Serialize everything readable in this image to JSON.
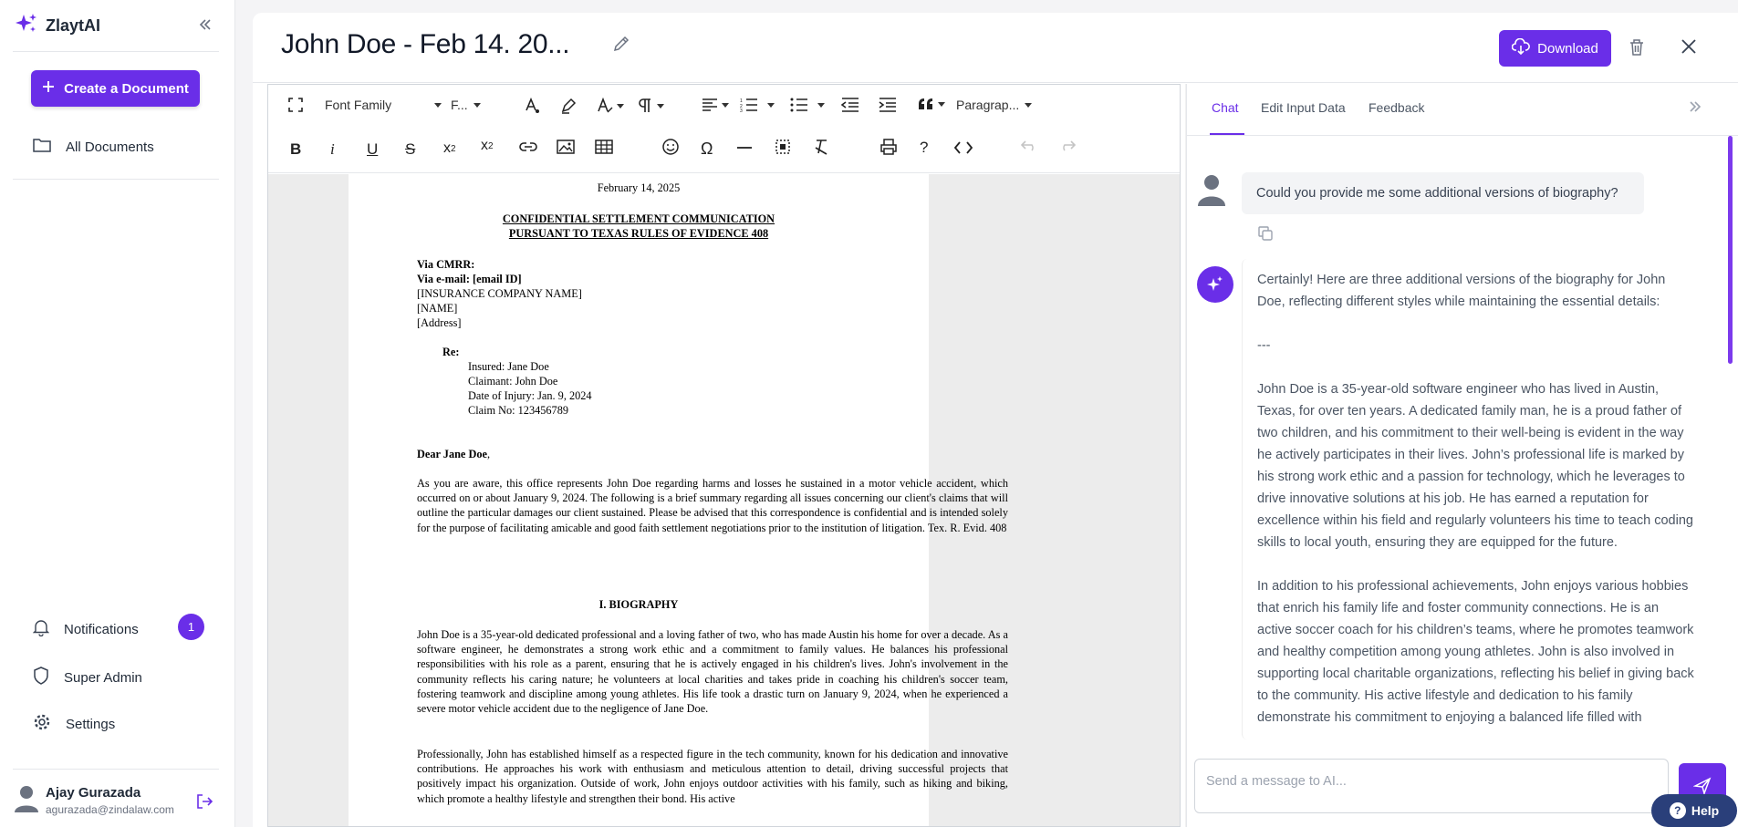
{
  "app": {
    "name": "ZlaytAI"
  },
  "sidebar": {
    "create_label": "Create a Document",
    "all_documents": "All Documents",
    "notifications": "Notifications",
    "notifications_count": "1",
    "super_admin": "Super Admin",
    "settings": "Settings",
    "user_name": "Ajay Gurazada",
    "user_email": "agurazada@zindalaw.com"
  },
  "header": {
    "title": "John Doe - Feb 14. 20...",
    "download_label": "Download"
  },
  "toolbar": {
    "font_family": "Font Family",
    "font_size": "F...",
    "paragraph": "Paragrap..."
  },
  "document": {
    "date": "February 14, 2025",
    "heading1": "CONFIDENTIAL SETTLEMENT COMMUNICATION",
    "heading2": "PURSUANT TO TEXAS RULES OF EVIDENCE 408",
    "via_cmrr": "Via CMRR:",
    "via_email": "Via e-mail: [email ID]",
    "insurance": "[INSURANCE COMPANY NAME]",
    "name": "[NAME]",
    "address": "[Address]",
    "re": "Re:",
    "insured": "Insured: Jane Doe",
    "claimant": "Claimant: John Doe",
    "doi": "Date of Injury: Jan. 9, 2024",
    "claim_no": "Claim No: 123456789",
    "salutation_bold": "Dear Jane Doe",
    "salutation_rest": ",",
    "intro": "As you are aware, this office represents John Doe regarding harms and losses he sustained in a motor vehicle accident, which occurred on or about January 9, 2024. The following is a brief summary regarding all issues concerning our client's claims that will outline the particular damages our client sustained. Please be advised that this correspondence is confidential and is intended solely for the purpose of facilitating amicable and good faith settlement negotiations prior to the institution of litigation. Tex. R. Evid. 408",
    "section_title": "I. BIOGRAPHY",
    "bio1": "John Doe is a 35-year-old dedicated professional and a loving father of two, who has made Austin his home for over a decade. As a software engineer, he demonstrates a strong work ethic and a commitment to family values. He balances his professional responsibilities with his role as a parent, ensuring that he is actively engaged in his children's lives. John's involvement in the community reflects his caring nature; he volunteers at local charities and takes pride in coaching his children's soccer team, fostering teamwork and discipline among young athletes. His life took a drastic turn on January 9, 2024, when he experienced a severe motor vehicle accident due to the negligence of Jane Doe.",
    "bio2": "Professionally, John has established himself as a respected figure in the tech community, known for his dedication and innovative contributions. He approaches his work with enthusiasm and meticulous attention to detail, driving successful projects that positively impact his organization. Outside of work, John enjoys outdoor activities with his family, such as hiking and biking, which promote a healthy lifestyle and strengthen their bond. His active"
  },
  "chat": {
    "tabs": [
      "Chat",
      "Edit Input Data",
      "Feedback"
    ],
    "user_message": "Could you provide me some additional versions of biography?",
    "ai_p1": "Certainly! Here are three additional versions of the biography for John Doe, reflecting different styles while maintaining the essential details:",
    "ai_p2": "---",
    "ai_p3": "John Doe is a 35-year-old software engineer who has lived in Austin, Texas, for over ten years. A dedicated family man, he is a proud father of two children, and his commitment to their well-being is evident in the way he actively participates in their lives. John’s professional life is marked by his strong work ethic and a passion for technology, which he leverages to drive innovative solutions at his job. He has earned a reputation for excellence within his field and regularly volunteers his time to teach coding skills to local youth, ensuring they are equipped for the future.",
    "ai_p4": "In addition to his professional achievements, John enjoys various hobbies that enrich his family life and foster community connections. He is an active soccer coach for his children’s teams, where he promotes teamwork and healthy competition among young athletes. John is also involved in supporting local charitable organizations, reflecting his belief in giving back to the community. His active lifestyle and dedication to his family demonstrate his commitment to enjoying a balanced life filled with",
    "input_placeholder": "Send a message to AI...",
    "help_label": "Help"
  }
}
